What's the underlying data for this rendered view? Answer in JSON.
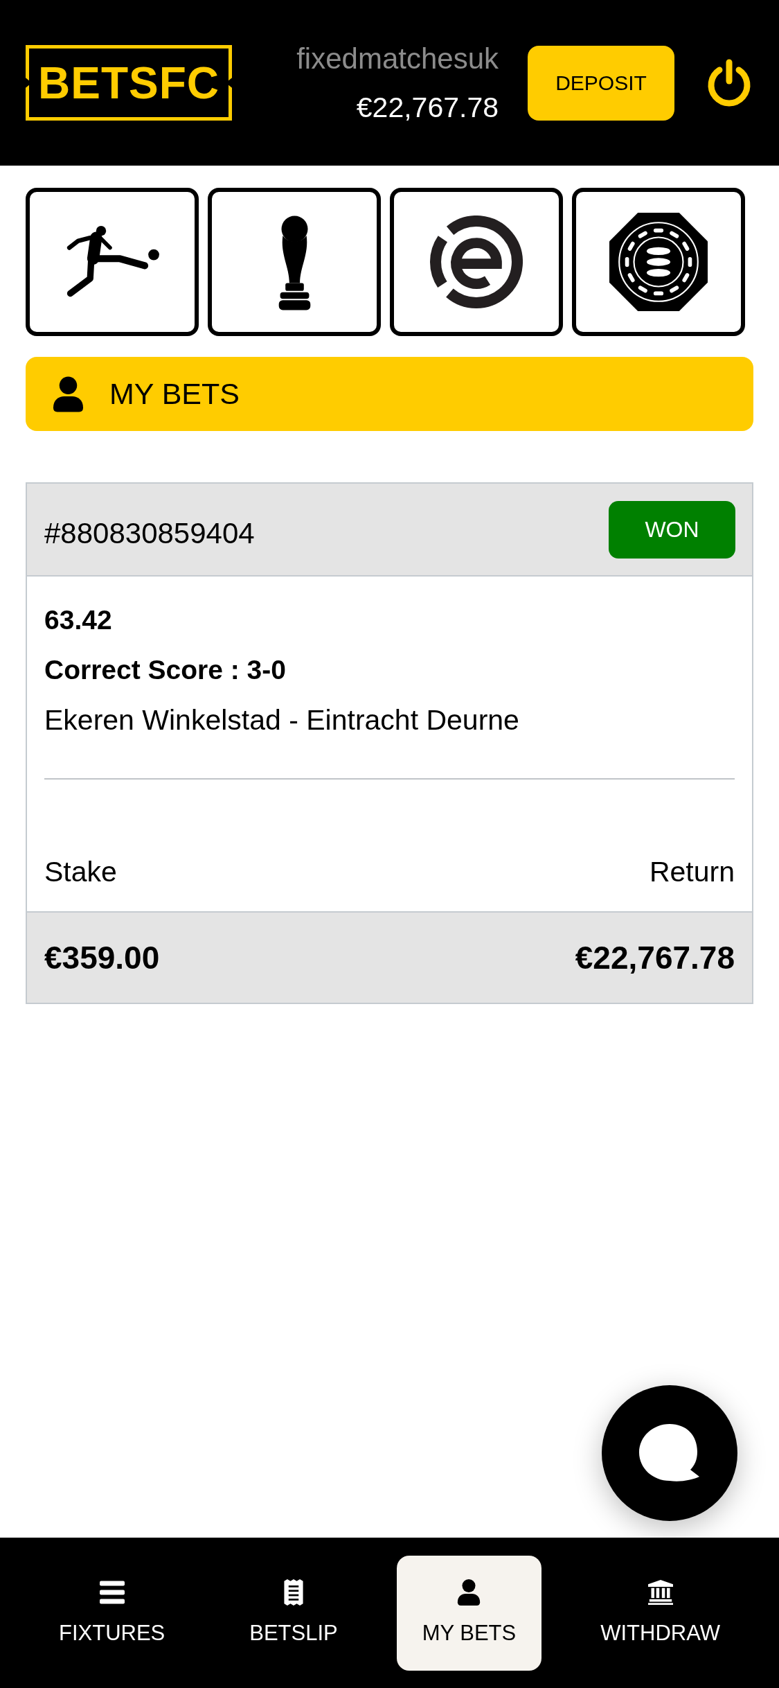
{
  "header": {
    "logo": "BETSFC",
    "username": "fixedmatchesuk",
    "balance": "€22,767.78",
    "deposit_button": "DEPOSIT"
  },
  "section_title": "MY BETS",
  "bets": [
    {
      "id": "#880830859404",
      "status": {
        "label": "WON",
        "kind": "won"
      },
      "odds": "63.42",
      "market": "Correct Score : 3-0",
      "event": "Ekeren Winkelstad - Eintracht Deurne",
      "stake_label": "Stake",
      "return_label": "Return",
      "stake": "€359.00",
      "return": "€22,767.78"
    }
  ],
  "nav": [
    {
      "label": "FIXTURES",
      "selected": false
    },
    {
      "label": "BETSLIP",
      "selected": false
    },
    {
      "label": "MY BETS",
      "selected": true
    },
    {
      "label": "WITHDRAW",
      "selected": false
    }
  ]
}
